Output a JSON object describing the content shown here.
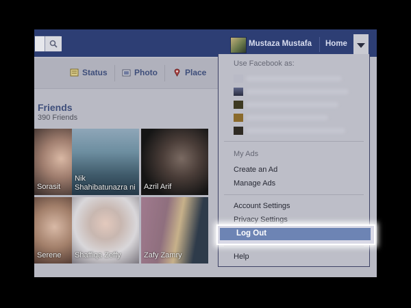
{
  "topbar": {
    "profile_name": "Mustaza Mustafa",
    "home_label": "Home"
  },
  "composer": {
    "status_label": "Status",
    "photo_label": "Photo",
    "place_label": "Place"
  },
  "friends": {
    "title": "Friends",
    "count": "390 Friends",
    "tiles": [
      {
        "name": "Sorasit"
      },
      {
        "name": "Nik Shahibatunazra ni"
      },
      {
        "name": "Azril Arif"
      },
      {
        "name": "Serene"
      },
      {
        "name": "Shaffiqa Zeffy"
      },
      {
        "name": "Zafy Zamry"
      }
    ]
  },
  "dropdown": {
    "use_as_label": "Use Facebook as:",
    "my_ads_label": "My Ads",
    "create_ad": "Create an Ad",
    "manage_ads": "Manage Ads",
    "account_settings": "Account Settings",
    "privacy_settings": "Privacy Settings",
    "log_out": "Log Out",
    "help": "Help"
  },
  "colors": {
    "brand_bar": "#2d3e74",
    "highlight": "#6d84b4",
    "dim_overlay": "#b9bac4"
  },
  "icons": [
    "search-icon",
    "chevron-down-icon",
    "status-icon",
    "photo-icon",
    "place-icon"
  ]
}
